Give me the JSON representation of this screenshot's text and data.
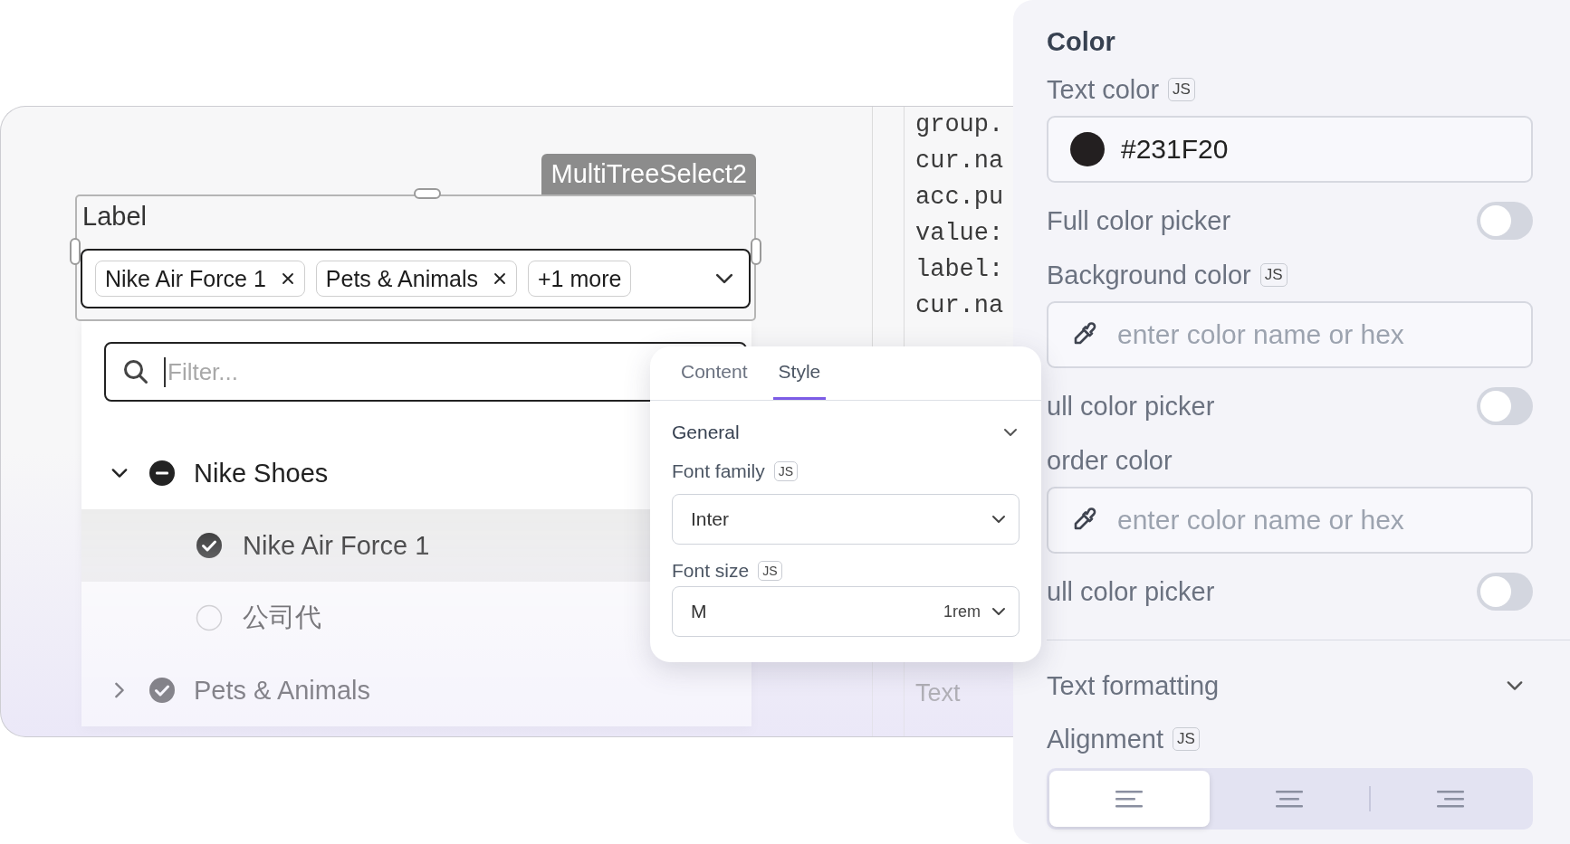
{
  "canvas": {
    "component_tag": "MultiTreeSelect2",
    "label": "Label",
    "chips": [
      {
        "text": "Nike Air Force 1",
        "removable": true
      },
      {
        "text": "Pets & Animals",
        "removable": true
      },
      {
        "text": "+1 more",
        "removable": false
      }
    ],
    "filter": {
      "placeholder": "Filter..."
    },
    "tree": [
      {
        "label": "Nike Shoes",
        "expanded": true,
        "children": [
          {
            "label": "Nike Air Force 1",
            "checked": true,
            "selected": true
          },
          {
            "label": "公司代",
            "checked": false,
            "selected": false
          }
        ]
      },
      {
        "label": "Pets & Animals",
        "expanded": false,
        "checked": true
      }
    ],
    "code_lines": [
      "group.",
      "cur.na",
      "acc.pu",
      "value:",
      "label:",
      "cur.na"
    ],
    "code_footer": "Text"
  },
  "inspector": {
    "tabs": [
      {
        "label": "Content",
        "selected": false
      },
      {
        "label": "Style",
        "selected": true
      }
    ],
    "section": {
      "label": "General",
      "expanded": true
    },
    "fields": [
      {
        "label": "Font family",
        "badge": "JS",
        "value": "Inter"
      },
      {
        "label": "Font size",
        "badge": "JS",
        "value": "M",
        "suffix": "1rem"
      }
    ]
  },
  "panel": {
    "title": "Color",
    "rows": [
      {
        "kind": "label",
        "text": "Text color",
        "badge": "JS"
      },
      {
        "kind": "color-field",
        "value": "#231F20",
        "color": "#231f20"
      },
      {
        "kind": "toggle",
        "label": "Full color picker",
        "on": false
      },
      {
        "kind": "label",
        "text": "Background color",
        "badge": "JS"
      },
      {
        "kind": "color-field",
        "placeholder": "enter color name or hex"
      },
      {
        "kind": "toggle",
        "label": "ull color picker",
        "on": false
      },
      {
        "kind": "label",
        "text": "order color"
      },
      {
        "kind": "color-field",
        "placeholder": "enter color name or hex"
      },
      {
        "kind": "toggle",
        "label": "ull color picker",
        "on": false
      },
      {
        "kind": "divider"
      },
      {
        "kind": "section",
        "label": "Text formatting",
        "expanded": true
      },
      {
        "kind": "label",
        "text": "Alignment",
        "badge": "JS"
      },
      {
        "kind": "segmented",
        "options": [
          {
            "kind": "align-left",
            "selected": true
          },
          {
            "kind": "align-center",
            "selected": false
          },
          {
            "kind": "align-right",
            "selected": false
          }
        ]
      }
    ]
  }
}
